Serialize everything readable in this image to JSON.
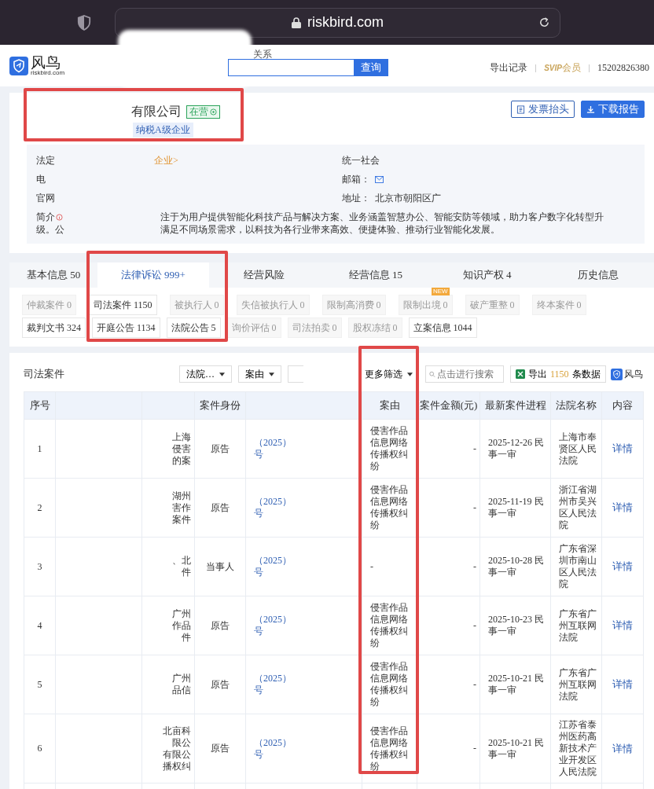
{
  "browser": {
    "url": "riskbird.com"
  },
  "header": {
    "logo_text": "风鸟",
    "logo_sub": "riskbird.com",
    "search_hint": "关系",
    "search_button": "查询",
    "links": [
      {
        "kind": "link",
        "text": "导出记录"
      },
      {
        "kind": "vip",
        "text": "SVIP",
        "suffix": "会员"
      },
      {
        "kind": "phone",
        "text": "15202826380"
      }
    ]
  },
  "company": {
    "name": "有限公司",
    "status": "在营",
    "tags": [
      "纳税A级企业"
    ],
    "buttons": [
      {
        "kind": "outline",
        "text": "发票抬头"
      },
      {
        "kind": "primary",
        "text": "下载报告"
      }
    ],
    "info_left": [
      {
        "label": "法定",
        "link": "企业>"
      },
      {
        "label": "电"
      },
      {
        "label": "官网"
      }
    ],
    "info_right": [
      {
        "label": "统一社会"
      },
      {
        "label": "邮箱：",
        "mail": true
      },
      {
        "label": "地址：",
        "value": "北京市朝阳区广"
      }
    ],
    "intro_label": "简介",
    "intro_line1": "注于为用户提供智能化科技产品与解决方案、业务涵盖智慧办公、智能安防等领域，助力客户数字化转型升",
    "intro_line2a": "级。公",
    "intro_line2b": "满足不同场景需求，以科技为各行业带来高效、便捷体验、推动行业智能化发展。"
  },
  "tabs": [
    {
      "label": "基本信息 50",
      "selected": false
    },
    {
      "label": "法律诉讼 999+",
      "selected": true
    },
    {
      "label": "经营风险",
      "selected": false
    },
    {
      "label": "经营信息 15",
      "selected": false
    },
    {
      "label": "知识产权 4",
      "selected": false
    },
    {
      "label": "历史信息",
      "selected": false
    }
  ],
  "chips": [
    [
      {
        "label": "仲裁案件",
        "count": "0",
        "disabled": true
      },
      {
        "label": "司法案件",
        "count": "1150",
        "disabled": false
      },
      {
        "label": "被执行人",
        "count": "0",
        "disabled": true
      },
      {
        "label": "失信被执行人",
        "count": "0",
        "disabled": true
      },
      {
        "label": "限制高消费",
        "count": "0",
        "disabled": true
      },
      {
        "label": "限制出境",
        "count": "0",
        "disabled": true,
        "badge": "NEW"
      },
      {
        "label": "破产重整",
        "count": "0",
        "disabled": true
      },
      {
        "label": "终本案件",
        "count": "0",
        "disabled": true
      }
    ],
    [
      {
        "label": "裁判文书",
        "count": "324",
        "disabled": false
      },
      {
        "label": "开庭公告",
        "count": "1134",
        "disabled": false
      },
      {
        "label": "法院公告",
        "count": "5",
        "disabled": false
      },
      {
        "label": "询价评估",
        "count": "0",
        "disabled": true
      },
      {
        "label": "司法拍卖",
        "count": "0",
        "disabled": true
      },
      {
        "label": "股权冻结",
        "count": "0",
        "disabled": true
      },
      {
        "label": "立案信息",
        "count": "1044",
        "disabled": false
      }
    ]
  ],
  "section": {
    "title": "司法案件",
    "filters": [
      "法院…",
      "案由"
    ],
    "more_filter": "更多筛选",
    "search_placeholder": "点击进行搜索",
    "export": {
      "prefix": "导出",
      "count": "1150",
      "suffix": "条数据"
    },
    "brand": "风鸟"
  },
  "table": {
    "columns": [
      "序号",
      "",
      "",
      "案件身份",
      "",
      "案由",
      "案件金额(元)",
      "最新案件进程",
      "法院名称",
      "内容"
    ],
    "rows": [
      {
        "no": "1",
        "fragment": [
          "上海",
          "侵害",
          "的案"
        ],
        "role": "原告",
        "case_year": "（2025）",
        "case_tail": "号",
        "cause": "侵害作品信息网络传播权纠纷",
        "amount": "-",
        "progress": "2025-12-26 民事一审",
        "court": "上海市奉贤区人民法院",
        "detail": "详情"
      },
      {
        "no": "2",
        "fragment": [
          "湖州",
          "害作",
          "案件"
        ],
        "role": "原告",
        "case_year": "（2025）",
        "case_tail": "号",
        "cause": "侵害作品信息网络传播权纠纷",
        "amount": "-",
        "progress": "2025-11-19 民事一审",
        "court": "浙江省湖州市吴兴区人民法院",
        "detail": "详情"
      },
      {
        "no": "3",
        "fragment": [
          "、北",
          "件"
        ],
        "role": "当事人",
        "case_year": "（2025）",
        "case_tail": "号",
        "cause": "-",
        "amount": "-",
        "progress": "2025-10-28 民事一审",
        "court": "广东省深圳市南山区人民法院",
        "detail": "详情"
      },
      {
        "no": "4",
        "fragment": [
          "广州",
          "作品",
          "件"
        ],
        "role": "原告",
        "case_year": "（2025）",
        "case_tail": "号",
        "cause": "侵害作品信息网络传播权纠纷",
        "amount": "-",
        "progress": "2025-10-23 民事一审",
        "court": "广东省广州互联网法院",
        "detail": "详情"
      },
      {
        "no": "5",
        "fragment": [
          "广州",
          "品信"
        ],
        "role": "原告",
        "case_year": "（2025）",
        "case_tail": "号",
        "cause": "侵害作品信息网络传播权纠纷",
        "amount": "-",
        "progress": "2025-10-21 民事一审",
        "court": "广东省广州互联网法院",
        "detail": "详情"
      },
      {
        "no": "6",
        "fragment": [
          "北亩科",
          "限公",
          "有限公",
          "播权纠"
        ],
        "role": "原告",
        "case_year": "（2025）",
        "case_tail": "号",
        "cause": "侵害作品信息网络传播权纠纷",
        "amount": "-",
        "progress": "2025-10-21 民事一审",
        "court": "江苏省泰州医药高新技术产业开发区人民法院",
        "detail": "详情"
      }
    ]
  }
}
